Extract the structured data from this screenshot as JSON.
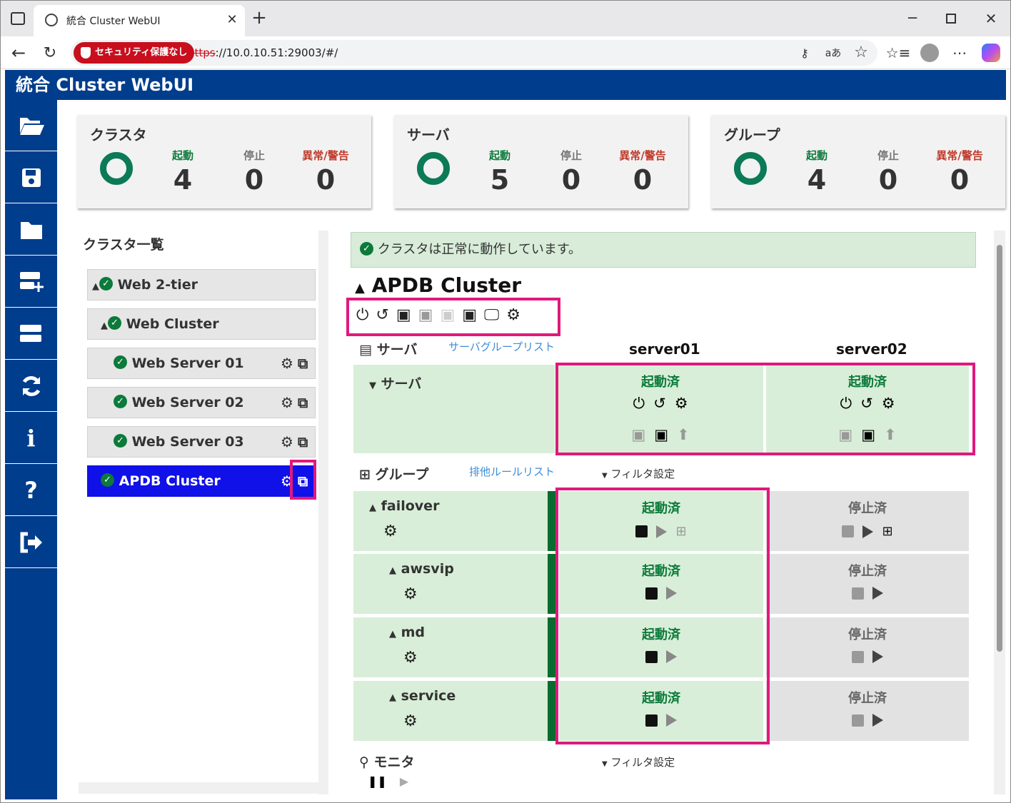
{
  "browser": {
    "tab_title": "統合 Cluster WebUI",
    "security_label": "セキュリティ保護なし",
    "url_scheme": "https",
    "url_rest": "://10.0.10.51:29003/#/"
  },
  "app": {
    "title": "統合 Cluster WebUI"
  },
  "summary": [
    {
      "title": "クラスタ",
      "running_label": "起動",
      "running": "4",
      "stopped_label": "停止",
      "stopped": "0",
      "error_label": "異常/警告",
      "error": "0"
    },
    {
      "title": "サーバ",
      "running_label": "起動",
      "running": "5",
      "stopped_label": "停止",
      "stopped": "0",
      "error_label": "異常/警告",
      "error": "0"
    },
    {
      "title": "グループ",
      "running_label": "起動",
      "running": "4",
      "stopped_label": "停止",
      "stopped": "0",
      "error_label": "異常/警告",
      "error": "0"
    }
  ],
  "cluster_list": {
    "title": "クラスタ一覧",
    "items": [
      {
        "label": "Web 2-tier"
      },
      {
        "label": "Web Cluster"
      },
      {
        "label": "Web Server 01"
      },
      {
        "label": "Web Server 02"
      },
      {
        "label": "Web Server 03"
      },
      {
        "label": "APDB Cluster"
      }
    ]
  },
  "detail": {
    "alert": "クラスタは正常に動作しています。",
    "cluster_name": "APDB Cluster",
    "server_section": "サーバ",
    "server_link": "サーバグループリスト",
    "servers": [
      "server01",
      "server02"
    ],
    "server_row_label": "サーバ",
    "server_status": [
      "起動済",
      "起動済"
    ],
    "group_section": "グループ",
    "group_link": "排他ルールリスト",
    "filter": "フィルタ設定",
    "groups": [
      {
        "name": "failover",
        "s1": "起動済",
        "s2": "停止済"
      },
      {
        "name": "awsvip",
        "s1": "起動済",
        "s2": "停止済"
      },
      {
        "name": "md",
        "s1": "起動済",
        "s2": "停止済"
      },
      {
        "name": "service",
        "s1": "起動済",
        "s2": "停止済"
      }
    ],
    "monitor_section": "モニタ",
    "monitor_filter": "フィルタ設定"
  },
  "colors": {
    "header": "#003d8c",
    "running": "#0b7a3a",
    "stopped_label": "#666666",
    "error": "#c0392b",
    "highlight": "#e0197d",
    "selected": "#1010e8"
  }
}
